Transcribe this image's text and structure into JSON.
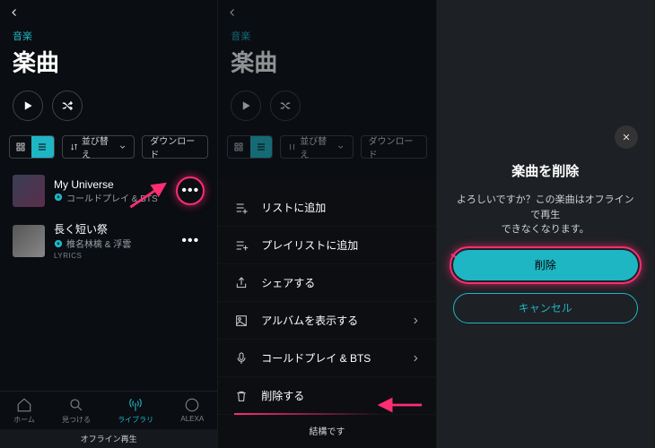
{
  "shared": {
    "breadcrumb": "音楽",
    "title": "楽曲",
    "sort_label": "並び替え",
    "download_label": "ダウンロード"
  },
  "screen1": {
    "tracks": [
      {
        "title": "My Universe",
        "artist": "コールドプレイ & BTS",
        "lyrics": ""
      },
      {
        "title": "長く短い祭",
        "artist": "椎名林檎 & 浮雲",
        "lyrics": "LYRICS"
      }
    ],
    "tabs": {
      "home": "ホーム",
      "find": "見つける",
      "library": "ライブラリ",
      "alexa": "ALEXA"
    },
    "offline": "オフライン再生"
  },
  "screen2": {
    "items": {
      "add_to_list": "リストに追加",
      "add_to_playlist": "プレイリストに追加",
      "share": "シェアする",
      "show_album": "アルバムを表示する",
      "artist": "コールドプレイ & BTS",
      "delete": "削除する"
    },
    "footer": "結構です"
  },
  "screen3": {
    "dialog_title": "楽曲を削除",
    "dialog_msg_line1": "よろしいですか？この楽曲はオフラインで再生",
    "dialog_msg_line2": "できなくなります。",
    "delete_btn": "削除",
    "cancel_btn": "キャンセル"
  },
  "colors": {
    "accent": "#1fb6c4",
    "annotation": "#ff2d72"
  }
}
